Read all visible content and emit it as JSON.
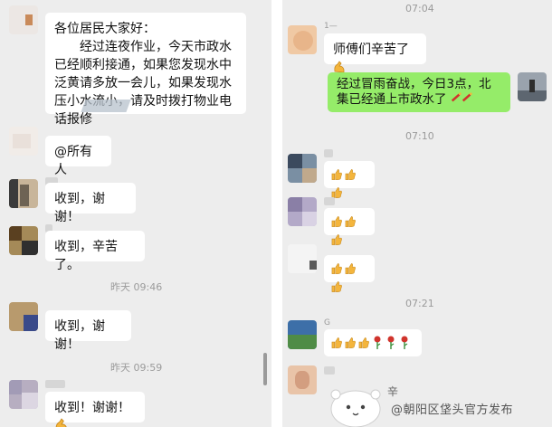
{
  "left_chat": {
    "messages": [
      {
        "text": "各位居民大家好：\n　　经过连夜作业，今天市政水已经顺利接通，如果您发现水中泛黄请多放一会儿，如果发现水压小水流小，请及时拨打物业电话报修"
      },
      {
        "text": "@所有人"
      },
      {
        "text": "收到，谢谢！"
      },
      {
        "text": "收到，辛苦了。"
      },
      {
        "text": "收到，谢谢！"
      },
      {
        "text": "收到！谢谢！"
      }
    ],
    "timestamps": [
      "昨天 09:46",
      "昨天 09:59"
    ]
  },
  "right_chat": {
    "timestamps": [
      "07:04",
      "07:10",
      "07:21"
    ],
    "messages": [
      {
        "text": "师傅们辛苦了"
      },
      {
        "text": "经过冒雨奋战，今日3点，北集已经通上市政水了"
      }
    ],
    "sender_name_partial": "1—"
  },
  "watermark": {
    "text": "@朝阳区垡头官方发布",
    "mascot_label": "辛"
  },
  "icons": {
    "thumb": "thumbs-up-emoji",
    "rose": "rose-emoji",
    "strong": "strong-arm-emoji",
    "firecracker": "firecracker-emoji"
  },
  "colors": {
    "background": "#ededed",
    "bubble": "#ffffff",
    "own_bubble": "#95ec69",
    "timestamp": "#9b9b9b"
  }
}
